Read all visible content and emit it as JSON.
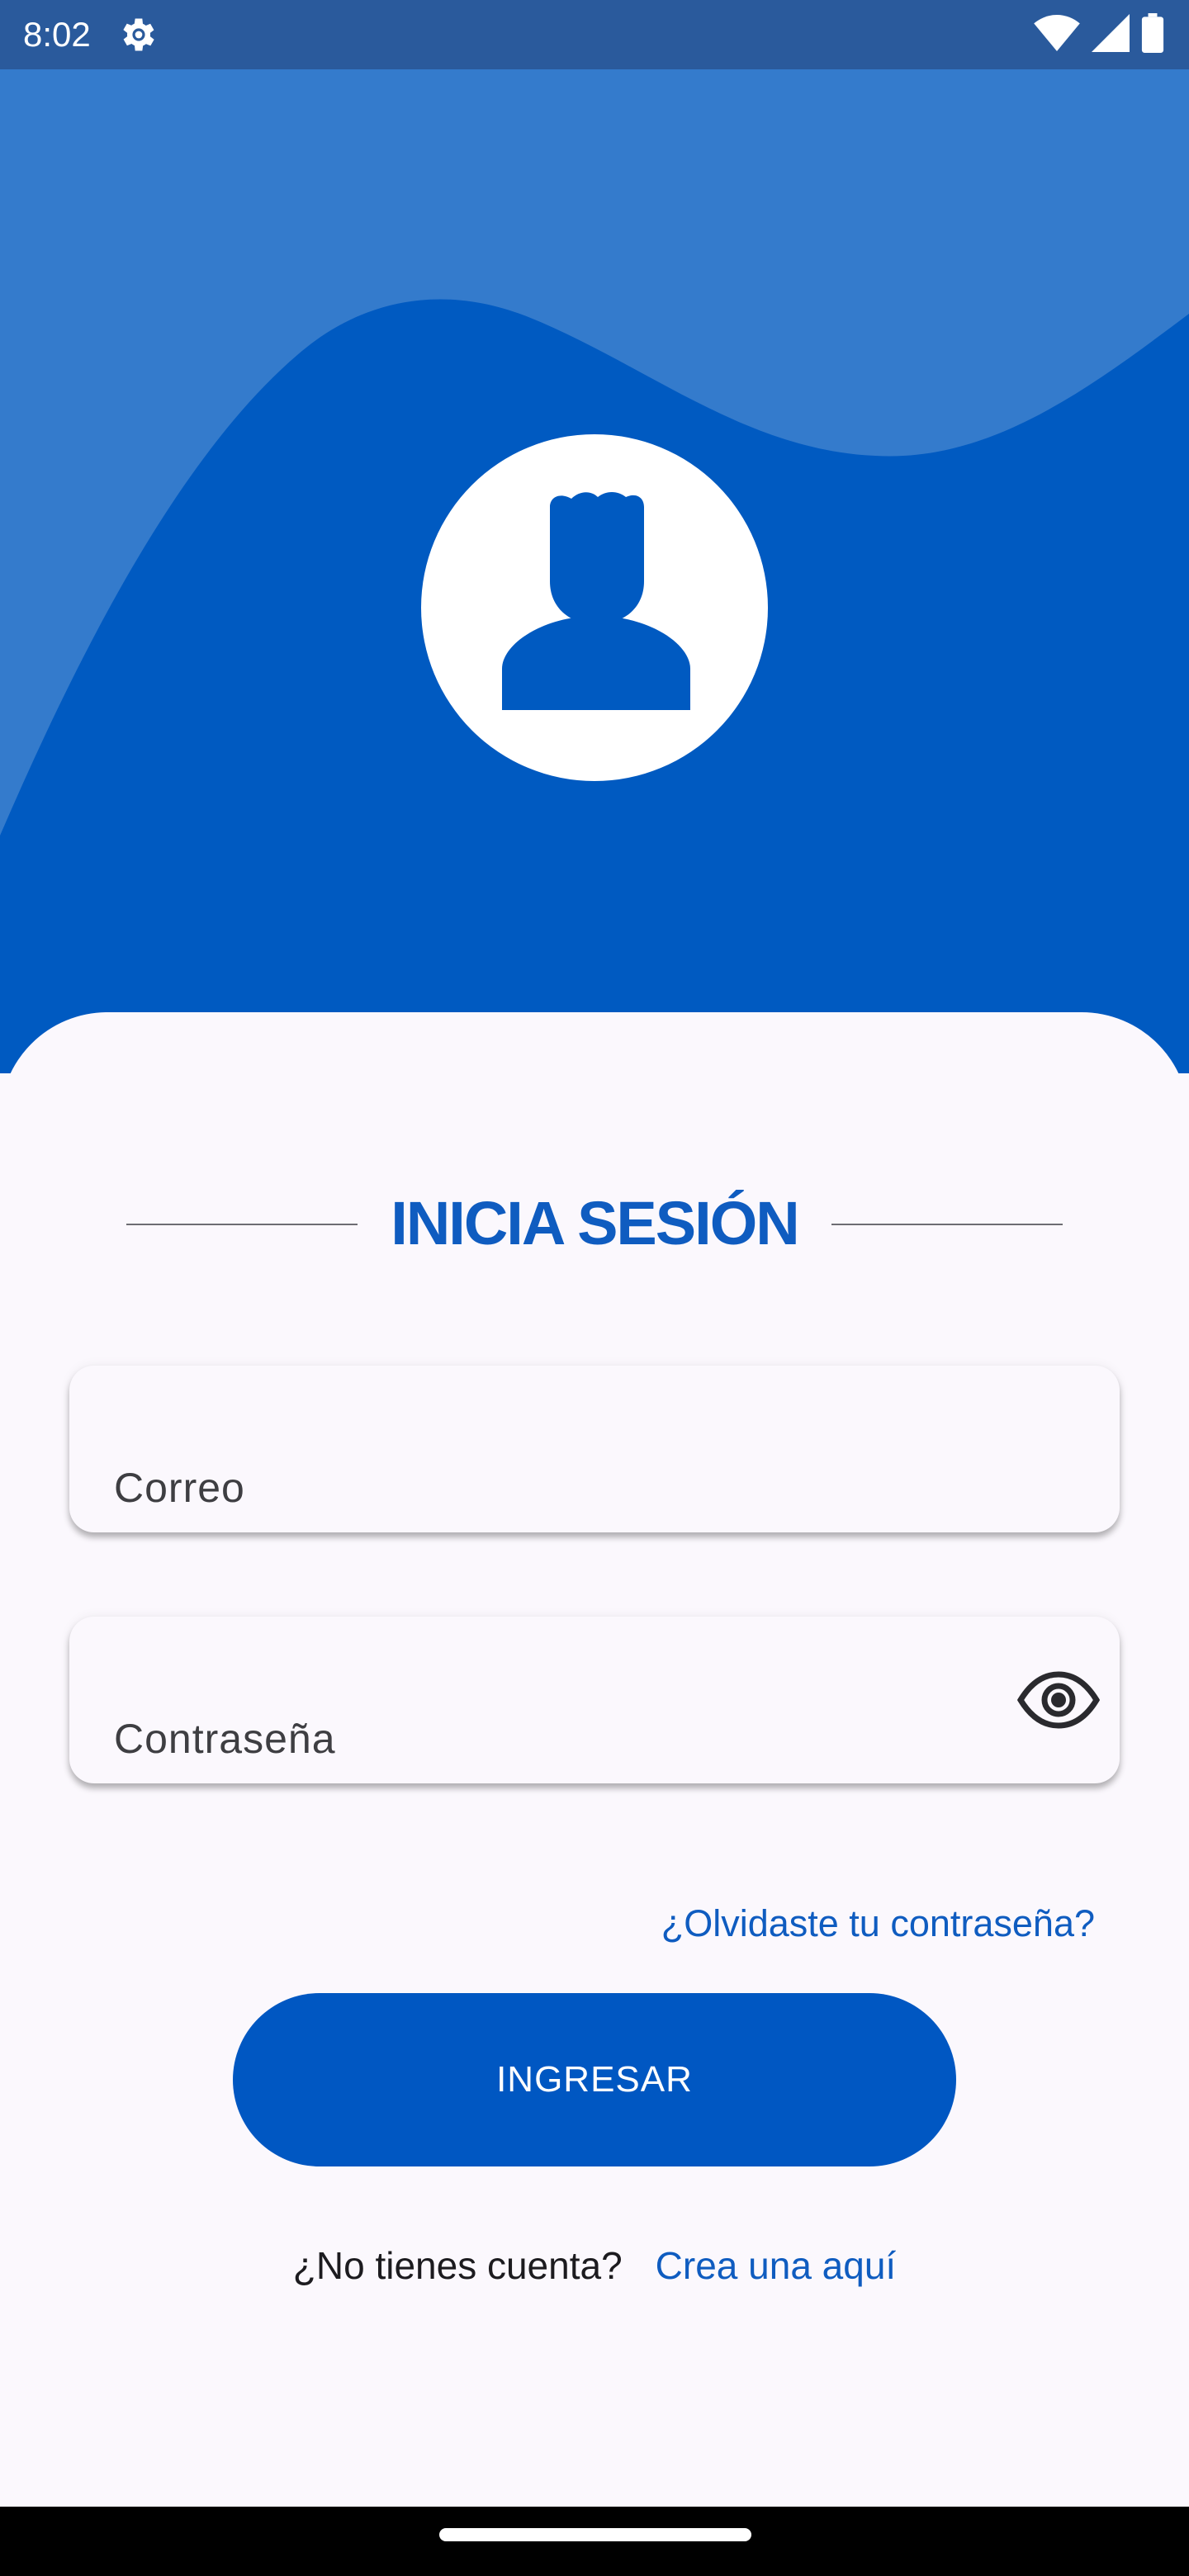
{
  "status_bar": {
    "time": "8:02",
    "settings_icon": "settings-gear-icon",
    "icons": [
      "wifi-icon",
      "cellular-signal-icon",
      "battery-icon"
    ]
  },
  "colors": {
    "primary": "#0057c2",
    "header_light": "#347bcc",
    "header_dark": "#005ac1",
    "status_bar": "#2a5a9c",
    "background": "#fbf8fd"
  },
  "header": {
    "avatar_icon": "person-icon"
  },
  "login": {
    "title": "INICIA SESIÓN",
    "email_label": "Correo",
    "password_label": "Contraseña",
    "password_visibility_icon": "eye-icon",
    "forgot_link": "¿Olvidaste tu contraseña?",
    "submit_label": "INGRESAR",
    "signup_prompt": "¿No tienes cuenta?",
    "signup_link": "Crea una aquí"
  }
}
